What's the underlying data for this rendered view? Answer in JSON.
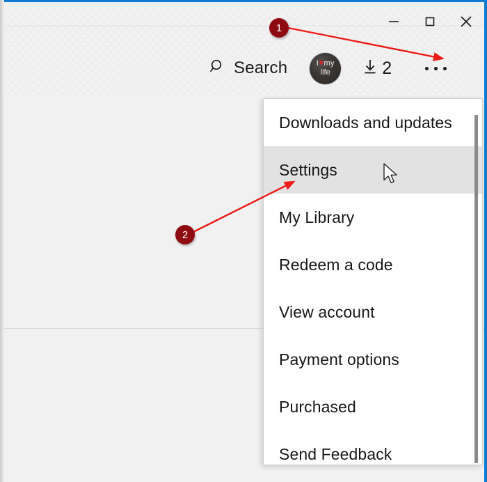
{
  "window": {
    "caption_buttons": [
      {
        "name": "minimize",
        "glyph": "minimize-icon"
      },
      {
        "name": "maximize",
        "glyph": "maximize-icon"
      },
      {
        "name": "close",
        "glyph": "close-icon"
      }
    ],
    "accent_color": "#0f7bd4",
    "titlebar_background": "#efefef",
    "body_background": "#f1f1f1"
  },
  "toolbar": {
    "search_label": "Search",
    "search_icon": "search-icon",
    "avatar": {
      "icon": "avatar",
      "line1_prefix": "I",
      "line1_heart": "♥",
      "line1_suffix": "my",
      "line2": "life"
    },
    "downloads": {
      "icon": "download-icon",
      "count": "2"
    },
    "more_icon": "ellipsis-icon"
  },
  "flyout_menu": {
    "selected_index": 1,
    "items": [
      {
        "label": "Downloads and updates"
      },
      {
        "label": "Settings"
      },
      {
        "label": "My Library"
      },
      {
        "label": "Redeem a code"
      },
      {
        "label": "View account"
      },
      {
        "label": "Payment options"
      },
      {
        "label": "Purchased"
      },
      {
        "label": "Send Feedback"
      }
    ],
    "scrollbar": {
      "name": "menu-scrollbar"
    }
  },
  "annotations": {
    "marker_color": "#8f0b12",
    "arrow_color": "#ee1c18",
    "markers": [
      {
        "label": "1",
        "target": "ellipsis-icon"
      },
      {
        "label": "2",
        "target": "menu-item-settings"
      }
    ]
  },
  "cursor": {
    "icon": "mouse-pointer-icon"
  }
}
